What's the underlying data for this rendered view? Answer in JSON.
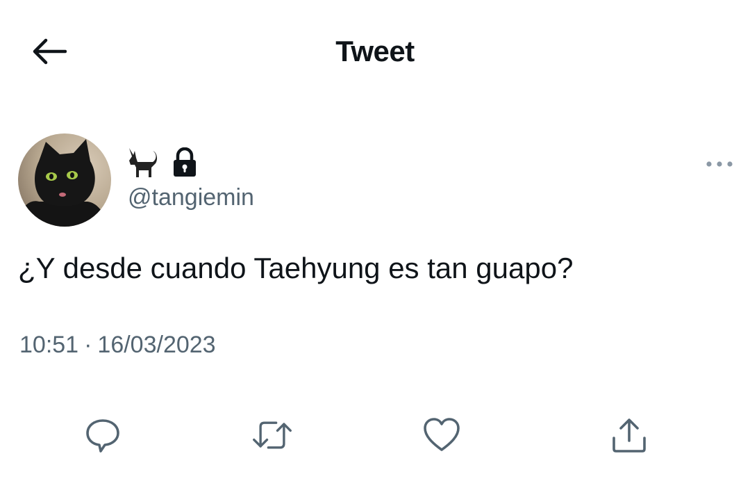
{
  "header": {
    "title": "Tweet",
    "back_icon": "arrow-left-icon"
  },
  "tweet": {
    "author": {
      "display_name_emoji": [
        "black-cat-emoji",
        "lock-icon"
      ],
      "handle": "@tangiemin",
      "avatar": "black-cat-avatar"
    },
    "text": "¿Y desde cuando Taehyung es tan guapo?",
    "time": "10:51",
    "separator": "·",
    "date": "16/03/2023"
  },
  "actions": [
    {
      "icon": "reply-icon"
    },
    {
      "icon": "retweet-icon"
    },
    {
      "icon": "like-icon"
    },
    {
      "icon": "share-icon"
    }
  ],
  "colors": {
    "text_primary": "#0f1419",
    "text_secondary": "#536471"
  }
}
